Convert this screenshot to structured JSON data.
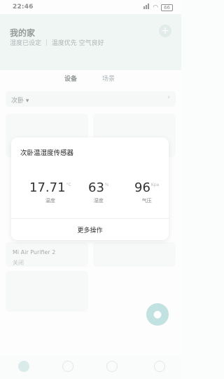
{
  "status": {
    "time": "22:46",
    "battery": "66"
  },
  "header": {
    "title": "我的家",
    "subtitle": "湿度已设定 ｜ 温度优先 空气良好",
    "plus": "+"
  },
  "tabs": [
    {
      "label": "设备"
    },
    {
      "label": "场景"
    }
  ],
  "room_selector": {
    "label": "次卧 ▾",
    "chevron": "›"
  },
  "cards": [
    {
      "name": "Mi Air Purifier 2",
      "status": "关闭"
    },
    {
      "name": "",
      "status": ""
    }
  ],
  "dialog": {
    "title": "次卧温湿度传感器",
    "metrics": [
      {
        "value": "17.71",
        "unit": "°C",
        "label": "温度"
      },
      {
        "value": "63",
        "unit": "%",
        "label": "湿度"
      },
      {
        "value": "96",
        "unit": "Kpa",
        "label": "气压"
      }
    ],
    "action": "更多操作"
  }
}
